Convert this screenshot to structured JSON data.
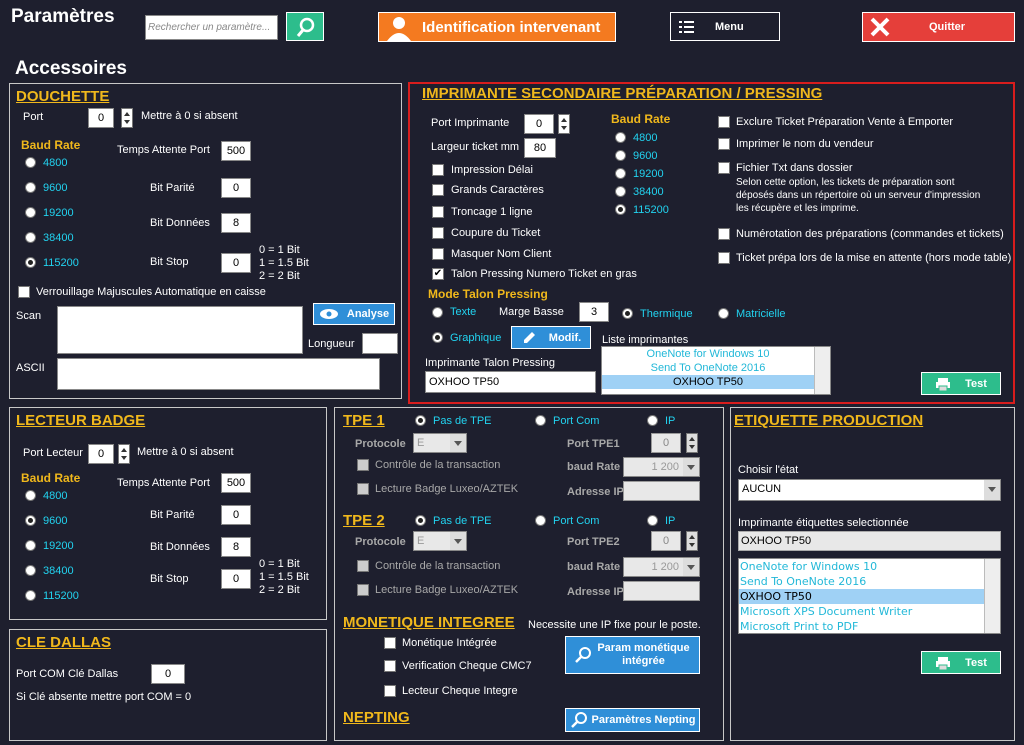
{
  "header": {
    "title": "Paramètres",
    "search_placeholder": "Rechercher un paramètre...",
    "identification": "Identification intervenant",
    "menu": "Menu",
    "quit": "Quitter"
  },
  "section_title": "Accessoires",
  "douchette": {
    "title": "DOUCHETTE",
    "port_label": "Port",
    "port_value": "0",
    "port_hint": "Mettre à 0 si absent",
    "baud_rate": "Baud Rate",
    "bauds": [
      "4800",
      "9600",
      "19200",
      "38400",
      "115200"
    ],
    "temps_label": "Temps Attente Port",
    "temps_value": "500",
    "parite_label": "Bit Parité",
    "parite_value": "0",
    "donnees_label": "Bit Données",
    "donnees_value": "8",
    "stop_label": "Bit Stop",
    "stop_value": "0",
    "stop_legend": [
      "0 = 1 Bit",
      "1 = 1.5 Bit",
      "2 = 2 Bit"
    ],
    "verrou": "Verrouillage Majuscules Automatique en caisse",
    "analyse": "Analyse",
    "scan": "Scan",
    "longueur": "Longueur",
    "ascii": "ASCII"
  },
  "imprimante": {
    "title": "IMPRIMANTE SECONDAIRE PRÉPARATION / PRESSING",
    "port_label": "Port Imprimante",
    "port_value": "0",
    "largeur_label": "Largeur ticket mm",
    "largeur_value": "80",
    "opts": [
      "Impression Délai",
      "Grands Caractères",
      "Troncage 1 ligne",
      "Coupure du Ticket",
      "Masquer Nom Client",
      "Talon Pressing Numero Ticket en gras"
    ],
    "baud_rate": "Baud Rate",
    "bauds": [
      "4800",
      "9600",
      "19200",
      "38400",
      "115200"
    ],
    "right_opts": [
      "Exclure Ticket Préparation Vente à Emporter",
      "Imprimer le nom du vendeur",
      "Fichier Txt dans dossier"
    ],
    "fichier_note": [
      "Selon cette option, les tickets de préparation sont",
      "déposés dans un répertoire où un serveur d'impression",
      "les récupère et les imprime."
    ],
    "numerotation": "Numérotation des préparations (commandes et tickets)",
    "mise_attente": "Ticket prépa lors de la mise en attente (hors mode table)",
    "mode_talon": "Mode Talon Pressing",
    "texte": "Texte",
    "marge_label": "Marge Basse",
    "marge_value": "3",
    "thermique": "Thermique",
    "matricielle": "Matricielle",
    "graphique": "Graphique",
    "modif": "Modif.",
    "liste_label": "Liste imprimantes",
    "liste": [
      "OneNote for Windows 10",
      "Send To OneNote 2016",
      "OXHOO TP50"
    ],
    "talon_label": "Imprimante Talon Pressing",
    "talon_value": "OXHOO TP50",
    "test": "Test"
  },
  "badge": {
    "title": "LECTEUR BADGE",
    "port_label": "Port Lecteur",
    "port_value": "0",
    "port_hint": "Mettre à 0 si absent",
    "baud_rate": "Baud Rate",
    "bauds": [
      "4800",
      "9600",
      "19200",
      "38400",
      "115200"
    ],
    "temps_label": "Temps Attente Port",
    "temps_value": "500",
    "parite_label": "Bit Parité",
    "parite_value": "0",
    "donnees_label": "Bit Données",
    "donnees_value": "8",
    "stop_label": "Bit Stop",
    "stop_value": "0",
    "stop_legend": [
      "0 = 1 Bit",
      "1 = 1.5 Bit",
      "2 = 2 Bit"
    ]
  },
  "dallas": {
    "title": "CLE DALLAS",
    "port_label": "Port COM Clé Dallas",
    "port_value": "0",
    "hint": "Si Clé absente mettre port COM = 0"
  },
  "tpe1": {
    "title": "TPE 1",
    "pas": "Pas de TPE",
    "portcom": "Port Com",
    "ip": "IP",
    "protocole": "Protocole",
    "proto_value": "E",
    "controle": "Contrôle de la transaction",
    "lecture": "Lecture Badge Luxeo/AZTEK",
    "port_tpe": "Port TPE1",
    "port_value": "0",
    "baud": "baud Rate",
    "baud_value": "1 200",
    "adresse": "Adresse IP"
  },
  "tpe2": {
    "title": "TPE 2",
    "pas": "Pas de TPE",
    "portcom": "Port Com",
    "ip": "IP",
    "protocole": "Protocole",
    "proto_value": "E",
    "controle": "Contrôle de la transaction",
    "lecture": "Lecture Badge Luxeo/AZTEK",
    "port_tpe": "Port TPE2",
    "port_value": "0",
    "baud": "baud Rate",
    "baud_value": "1 200",
    "adresse": "Adresse IP"
  },
  "monetique": {
    "title": "MONETIQUE INTEGREE",
    "note": "Necessite une IP fixe pour le poste.",
    "opts": [
      "Monétique Intégrée",
      "Verification Cheque CMC7",
      "Lecteur Cheque Integre"
    ],
    "param_btn": "Param monétique intégrée",
    "nepting": "NEPTING",
    "nepting_btn": "Paramètres Nepting"
  },
  "etiquette": {
    "title": "ETIQUETTE PRODUCTION",
    "etat_label": "Choisir l'état",
    "etat_value": "AUCUN",
    "imp_label": "Imprimante étiquettes selectionnée",
    "imp_value": "OXHOO TP50",
    "liste": [
      "OneNote for Windows 10",
      "Send To OneNote 2016",
      "OXHOO TP50",
      "Microsoft XPS Document Writer",
      "Microsoft Print to PDF"
    ],
    "test": "Test"
  },
  "colors": {
    "bg": "#1e1f2e",
    "gold": "#f0b81c",
    "cyan": "#22d3f0",
    "orange": "#f47a20",
    "red": "#e53f3a",
    "blue": "#2f8fd8",
    "green": "#2dbd8c"
  }
}
